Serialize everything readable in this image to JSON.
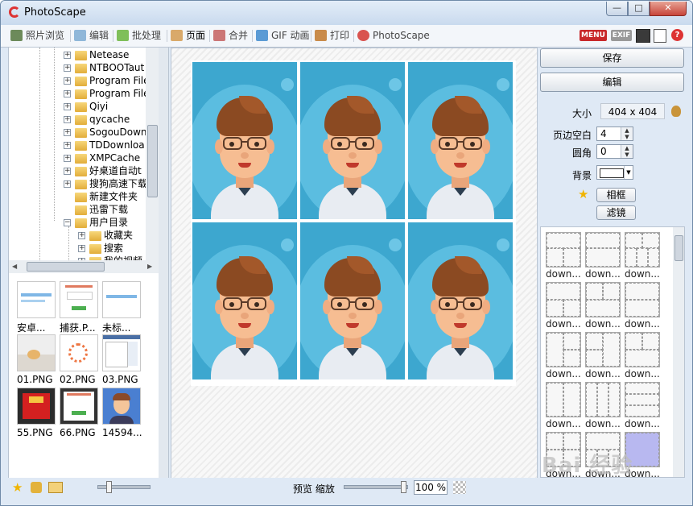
{
  "window": {
    "title": "PhotoScape",
    "min_label": "—",
    "max_label": "□",
    "close_label": "✕"
  },
  "tabs": [
    {
      "label": "照片浏览",
      "color": "#6c8a5a"
    },
    {
      "label": "编辑",
      "color": "#8fb7d9"
    },
    {
      "label": "批处理",
      "color": "#7fbf5a"
    },
    {
      "label": "页面",
      "color": "#d9a96a"
    },
    {
      "label": "合并",
      "color": "#c77"
    },
    {
      "label": "GIF 动画",
      "color": "#5b9bd5"
    },
    {
      "label": "打印",
      "color": "#c98b4a"
    },
    {
      "label": "PhotoScape",
      "color": "#d9534f"
    }
  ],
  "toolbar_icons": {
    "menu": "MENU",
    "exif": "EXIF"
  },
  "tree": {
    "items": [
      {
        "label": "Netease",
        "indent": 0
      },
      {
        "label": "NTBOOTaut",
        "indent": 0
      },
      {
        "label": "Program File",
        "indent": 0
      },
      {
        "label": "Program File",
        "indent": 0
      },
      {
        "label": "Qiyi",
        "indent": 0
      },
      {
        "label": "qycache",
        "indent": 0
      },
      {
        "label": "SogouDown",
        "indent": 0
      },
      {
        "label": "TDDownloa",
        "indent": 0
      },
      {
        "label": "XMPCache",
        "indent": 0
      },
      {
        "label": "好桌道自动t",
        "indent": 0
      },
      {
        "label": "搜狗高速下载",
        "indent": 0
      },
      {
        "label": "新建文件夹",
        "indent": 0
      },
      {
        "label": "迅雷下载",
        "indent": 0
      },
      {
        "label": "用户目录",
        "indent": 0
      },
      {
        "label": "收藏夹",
        "indent": 1
      },
      {
        "label": "搜索",
        "indent": 1
      },
      {
        "label": "我的视频",
        "indent": 1
      }
    ]
  },
  "files": [
    {
      "label": "安卓..."
    },
    {
      "label": "捕获.P..."
    },
    {
      "label": "未标..."
    },
    {
      "label": "01.PNG"
    },
    {
      "label": "02.PNG"
    },
    {
      "label": "03.PNG"
    },
    {
      "label": "55.PNG"
    },
    {
      "label": "66.PNG"
    },
    {
      "label": "14594..."
    }
  ],
  "right_panel": {
    "save_label": "保存",
    "edit_label": "编辑",
    "size_label": "大小",
    "size_value": "404 x 404",
    "margin_label": "页边空白",
    "margin_value": "4",
    "corner_label": "圆角",
    "corner_value": "0",
    "bg_label": "背景",
    "frame_btn": "相框",
    "filter_btn": "滤镜",
    "frame_items": [
      {
        "label": "down..."
      },
      {
        "label": "down..."
      },
      {
        "label": "down..."
      },
      {
        "label": "down..."
      },
      {
        "label": "down..."
      },
      {
        "label": "down..."
      },
      {
        "label": "down..."
      },
      {
        "label": "down..."
      },
      {
        "label": "down..."
      },
      {
        "label": "down..."
      },
      {
        "label": "down..."
      },
      {
        "label": "down..."
      },
      {
        "label": "down..."
      },
      {
        "label": "down..."
      },
      {
        "label": "down..."
      }
    ]
  },
  "status": {
    "preview_label": "预览 缩放",
    "zoom_value": "100 %"
  },
  "watermark": "Bai 经验"
}
